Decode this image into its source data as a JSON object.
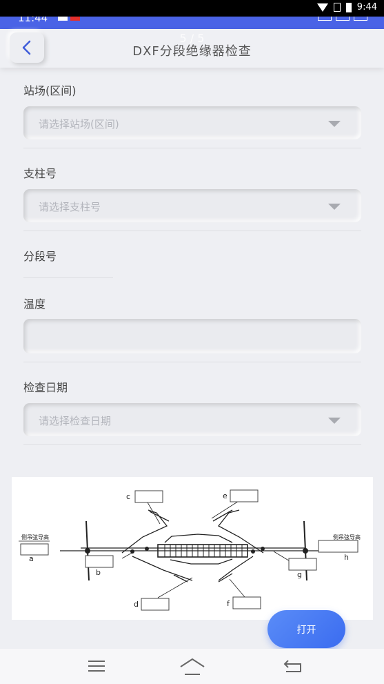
{
  "status_bar": {
    "time": "9:44"
  },
  "app_status": {
    "time": "11:44"
  },
  "header": {
    "title": "DXF分段绝缘器检查",
    "pager": "5 / 5"
  },
  "form": {
    "station": {
      "label": "站场(区间)",
      "placeholder": "请选择站场(区间)"
    },
    "pole": {
      "label": "支柱号",
      "placeholder": "请选择支柱号"
    },
    "section": {
      "label": "分段号"
    },
    "temperature": {
      "label": "温度",
      "value": ""
    },
    "inspect_date": {
      "label": "检查日期",
      "placeholder": "请选择检查日期"
    }
  },
  "diagram": {
    "left_caption": "侧吊弦导高",
    "right_caption": "侧吊弦导高",
    "letters": [
      "a",
      "b",
      "c",
      "d",
      "e",
      "f",
      "g",
      "h"
    ]
  },
  "open_button": {
    "label": "打开"
  },
  "nav_icons": [
    "menu-icon",
    "home-icon",
    "back-icon"
  ]
}
